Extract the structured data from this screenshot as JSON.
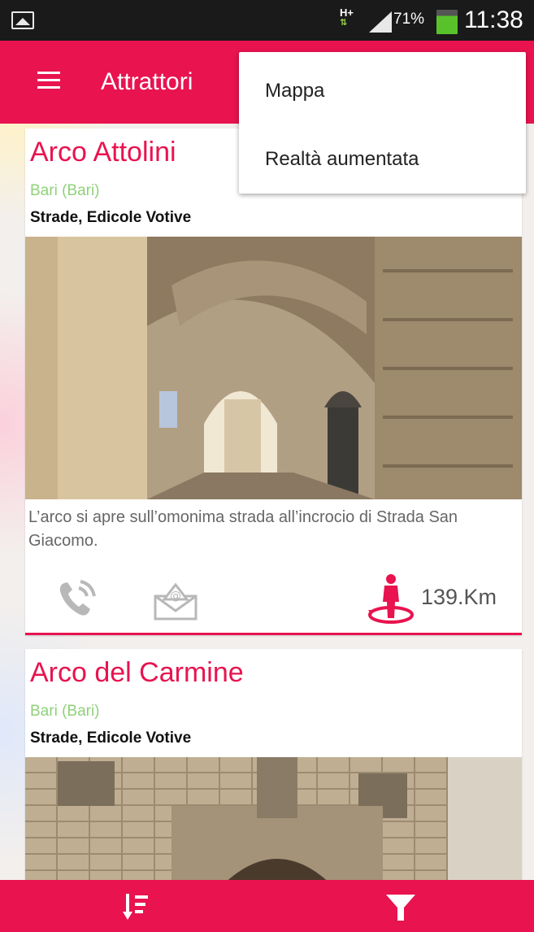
{
  "status_bar": {
    "network": "H+",
    "battery_percent": "71%",
    "time": "11:38",
    "icons": [
      "gallery-icon",
      "signal-icon",
      "battery-icon"
    ]
  },
  "app_bar": {
    "title": "Attrattori",
    "menu_icon": "hamburger-icon",
    "accent_color": "#e8134f"
  },
  "overflow_menu": {
    "items": [
      {
        "label": "Mappa"
      },
      {
        "label": "Realtà aumentata"
      }
    ]
  },
  "cards": [
    {
      "title": "Arco Attolini",
      "city": "Bari (Bari)",
      "category": "Strade, Edicole Votive",
      "description": "L’arco si apre sull’omonima strada all’incrocio di Strada San Giacomo.",
      "distance": "139.Km",
      "actions": [
        "phone-icon",
        "email-icon",
        "distance-icon"
      ]
    },
    {
      "title": "Arco del Carmine",
      "city": "Bari (Bari)",
      "category": "Strade, Edicole Votive"
    }
  ],
  "bottom_bar": {
    "buttons": [
      "sort-icon",
      "filter-icon"
    ]
  }
}
